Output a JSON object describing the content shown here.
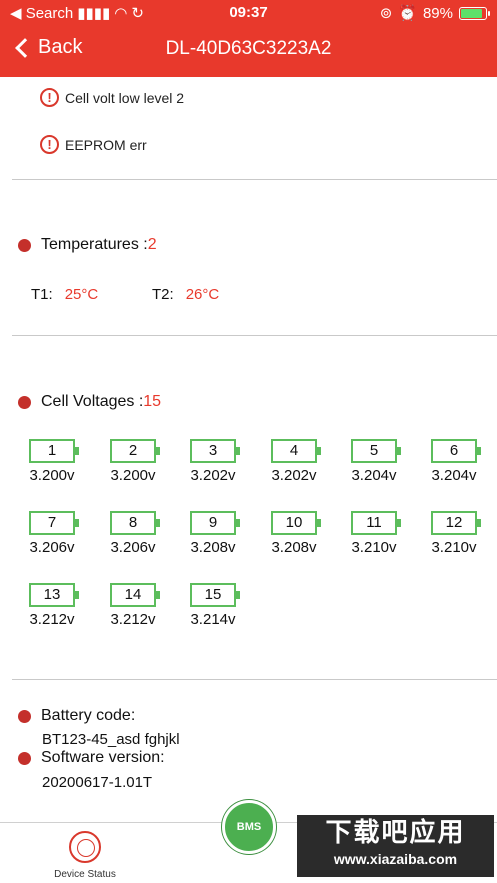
{
  "status_bar": {
    "carrier": "◀ Search",
    "time": "09:37",
    "battery_pct": "89%"
  },
  "nav": {
    "back_label": "Back",
    "title": "DL-40D63C3223A2"
  },
  "alerts": [
    "Cell volt low level 2",
    "EEPROM err"
  ],
  "temperatures": {
    "label": "Temperatures :",
    "count": "2",
    "items": [
      {
        "label": "T1:",
        "value": "25°C"
      },
      {
        "label": "T2:",
        "value": "26°C"
      }
    ]
  },
  "cell_voltages": {
    "label": "Cell Voltages :",
    "count": "15",
    "cells": [
      {
        "num": "1",
        "volt": "3.200v"
      },
      {
        "num": "2",
        "volt": "3.200v"
      },
      {
        "num": "3",
        "volt": "3.202v"
      },
      {
        "num": "4",
        "volt": "3.202v"
      },
      {
        "num": "5",
        "volt": "3.204v"
      },
      {
        "num": "6",
        "volt": "3.204v"
      },
      {
        "num": "7",
        "volt": "3.206v"
      },
      {
        "num": "8",
        "volt": "3.206v"
      },
      {
        "num": "9",
        "volt": "3.208v"
      },
      {
        "num": "10",
        "volt": "3.208v"
      },
      {
        "num": "11",
        "volt": "3.210v"
      },
      {
        "num": "12",
        "volt": "3.210v"
      },
      {
        "num": "13",
        "volt": "3.212v"
      },
      {
        "num": "14",
        "volt": "3.212v"
      },
      {
        "num": "15",
        "volt": "3.214v"
      }
    ]
  },
  "battery_code": {
    "label": "Battery code:",
    "value": "BT123-45_asd fghjkl"
  },
  "software_version": {
    "label": "Software version:",
    "value": "20200617-1.01T"
  },
  "tabbar": {
    "device_status_label": "Device Status",
    "bms_label": "BMS"
  },
  "watermark": {
    "top": "下载吧应用",
    "bottom": "www.xiazaiba.com"
  },
  "colors": {
    "accent": "#e8392c",
    "cell_border": "#5cbd5c",
    "dot": "#c4302b"
  }
}
